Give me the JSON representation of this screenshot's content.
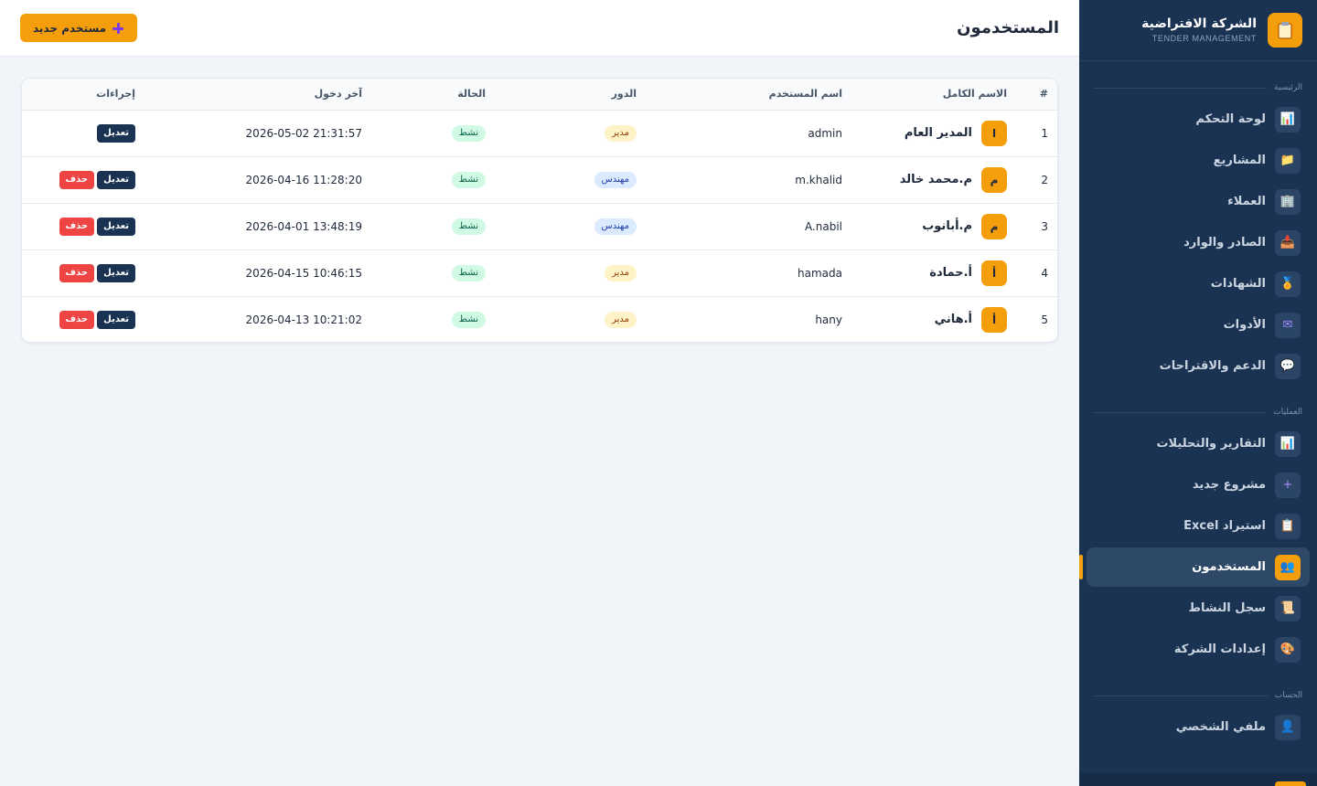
{
  "brand": {
    "name": "الشركة الافتراضية",
    "subtitle": "TENDER MANAGEMENT",
    "logo_icon": "clipboard-icon"
  },
  "sidebar": {
    "sections": [
      {
        "title": "الرئيسية",
        "items": [
          {
            "label": "لوحة التحكم",
            "icon": "chart-icon",
            "icon_glyph": "📊"
          },
          {
            "label": "المشاريع",
            "icon": "folder-icon",
            "icon_glyph": "📁"
          },
          {
            "label": "العملاء",
            "icon": "building-icon",
            "icon_glyph": "🏢"
          },
          {
            "label": "الصادر والوارد",
            "icon": "inbox-icon",
            "icon_glyph": "📥"
          },
          {
            "label": "الشهادات",
            "icon": "medal-icon",
            "icon_glyph": "🏅"
          },
          {
            "label": "الأدوات",
            "icon": "mail-icon",
            "icon_glyph": "✉"
          },
          {
            "label": "الدعم والاقتراحات",
            "icon": "chat-icon",
            "icon_glyph": "💬"
          }
        ]
      },
      {
        "title": "العمليات",
        "items": [
          {
            "label": "التقارير والتحليلات",
            "icon": "chart-icon",
            "icon_glyph": "📊"
          },
          {
            "label": "مشروع جديد",
            "icon": "plus-icon",
            "icon_glyph": "+"
          },
          {
            "label": "استيراد Excel",
            "icon": "clipboard-icon",
            "icon_glyph": "📋"
          },
          {
            "label": "المستخدمون",
            "icon": "users-icon",
            "icon_glyph": "👥",
            "active": true
          },
          {
            "label": "سجل النشاط",
            "icon": "scroll-icon",
            "icon_glyph": "📜"
          },
          {
            "label": "إعدادات الشركة",
            "icon": "palette-icon",
            "icon_glyph": "🎨"
          }
        ]
      },
      {
        "title": "الحساب",
        "items": [
          {
            "label": "ملفي الشخصي",
            "icon": "user-icon",
            "icon_glyph": "👤"
          }
        ]
      }
    ]
  },
  "header": {
    "title": "المستخدمون",
    "new_user_label": "مستخدم جديد"
  },
  "table": {
    "columns": [
      "#",
      "الاسم الكامل",
      "اسم المستخدم",
      "الدور",
      "الحالة",
      "آخر دخول",
      "إجراءات"
    ],
    "edit_label": "تعديل",
    "delete_label": "حذف",
    "rows": [
      {
        "num": "1",
        "avatar": "ا",
        "full_name": "المدير العام",
        "username": "admin",
        "role": "مدير",
        "role_type": "manager",
        "status": "نشط",
        "last_login": "2026-05-02 21:31:57",
        "can_delete": false
      },
      {
        "num": "2",
        "avatar": "م",
        "full_name": "م.محمد خالد",
        "username": "m.khalid",
        "role": "مهندس",
        "role_type": "engineer",
        "status": "نشط",
        "last_login": "2026-04-16 11:28:20",
        "can_delete": true
      },
      {
        "num": "3",
        "avatar": "م",
        "full_name": "م.أبانوب",
        "username": "A.nabil",
        "role": "مهندس",
        "role_type": "engineer",
        "status": "نشط",
        "last_login": "2026-04-01 13:48:19",
        "can_delete": true
      },
      {
        "num": "4",
        "avatar": "أ",
        "full_name": "أ.حمادة",
        "username": "hamada",
        "role": "مدير",
        "role_type": "manager",
        "status": "نشط",
        "last_login": "2026-04-15 10:46:15",
        "can_delete": true
      },
      {
        "num": "5",
        "avatar": "أ",
        "full_name": "أ.هاني",
        "username": "hany",
        "role": "مدير",
        "role_type": "manager",
        "status": "نشط",
        "last_login": "2026-04-13 10:21:02",
        "can_delete": true
      }
    ]
  },
  "colors": {
    "accent": "#f59e0b",
    "sidebar_bg": "#1b3352",
    "danger": "#ef4444",
    "page_bg": "#f1f5f9"
  }
}
